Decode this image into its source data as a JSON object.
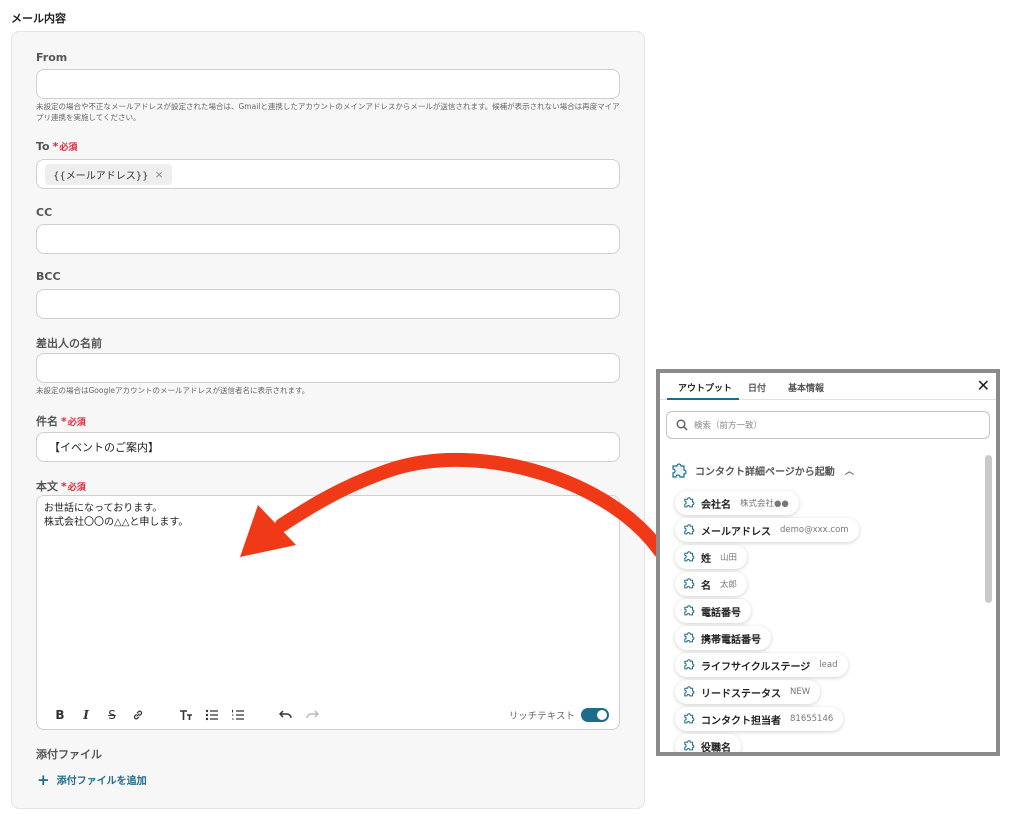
{
  "section_title": "メール内容",
  "form": {
    "from": {
      "label": "From",
      "value": "",
      "hint": "未設定の場合や不正なメールアドレスが設定された場合は、Gmailと連携したアカウントのメインアドレスからメールが送信されます。候補が表示されない場合は再度マイアプリ連携を実施してください。"
    },
    "to": {
      "label": "To",
      "required_mark": "*",
      "required_text": "必須",
      "chip": "{{メールアドレス}}",
      "chip_remove": "×"
    },
    "cc": {
      "label": "CC",
      "value": ""
    },
    "bcc": {
      "label": "BCC",
      "value": ""
    },
    "sender_name": {
      "label": "差出人の名前",
      "value": "",
      "hint": "未設定の場合はGoogleアカウントのメールアドレスが送信者名に表示されます。"
    },
    "subject": {
      "label": "件名",
      "required_mark": "*",
      "required_text": "必須",
      "value": "【イベントのご案内】"
    },
    "body": {
      "label": "本文",
      "required_mark": "*",
      "required_text": "必須",
      "lines": [
        "お世話になっております。",
        "株式会社〇〇の△△と申します。"
      ],
      "rich_text_label": "リッチテキスト",
      "rich_text_on": true
    },
    "attachments": {
      "label": "添付ファイル",
      "add_label": "添付ファイルを追加"
    }
  },
  "panel": {
    "tabs": [
      "アウトプット",
      "日付",
      "基本情報"
    ],
    "active_tab": 0,
    "search_placeholder": "検索（前方一致）",
    "group_title": "コンタクト詳細ページから起動",
    "items": [
      {
        "name": "会社名",
        "value": "株式会社●●"
      },
      {
        "name": "メールアドレス",
        "value": "demo@xxx.com"
      },
      {
        "name": "姓",
        "value": "山田"
      },
      {
        "name": "名",
        "value": "太郎"
      },
      {
        "name": "電話番号",
        "value": ""
      },
      {
        "name": "携帯電話番号",
        "value": ""
      },
      {
        "name": "ライフサイクルステージ",
        "value": "lead"
      },
      {
        "name": "リードステータス",
        "value": "NEW"
      },
      {
        "name": "コンタクト担当者",
        "value": "81655146"
      },
      {
        "name": "役職名",
        "value": ""
      }
    ]
  },
  "colors": {
    "accent": "#1c6c8c",
    "required": "#e0293a",
    "arrow": "#f03a17",
    "panel_border": "#8a8a8a"
  }
}
